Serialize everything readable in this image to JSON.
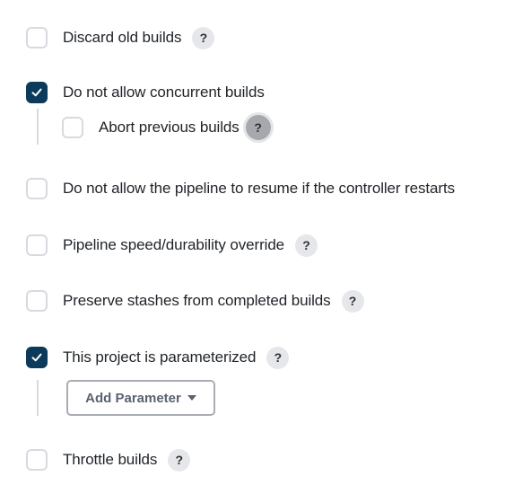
{
  "options": [
    {
      "label": "Discard old builds",
      "checked": false,
      "help": "?"
    },
    {
      "label": "Do not allow concurrent builds",
      "checked": true
    },
    {
      "label": "Abort previous builds",
      "checked": false,
      "help": "?"
    },
    {
      "label": "Do not allow the pipeline to resume if the controller restarts",
      "checked": false
    },
    {
      "label": "Pipeline speed/durability override",
      "checked": false,
      "help": "?"
    },
    {
      "label": "Preserve stashes from completed builds",
      "checked": false,
      "help": "?"
    },
    {
      "label": "This project is parameterized",
      "checked": true,
      "help": "?"
    },
    {
      "label": "Throttle builds",
      "checked": false,
      "help": "?"
    }
  ],
  "add_parameter": {
    "label": "Add Parameter"
  },
  "colors": {
    "checked": "#0b3a5b",
    "unchecked_border": "#d7dae0",
    "help_bg": "#e6e7ea",
    "help_hover_bg": "#a6a8ad"
  }
}
